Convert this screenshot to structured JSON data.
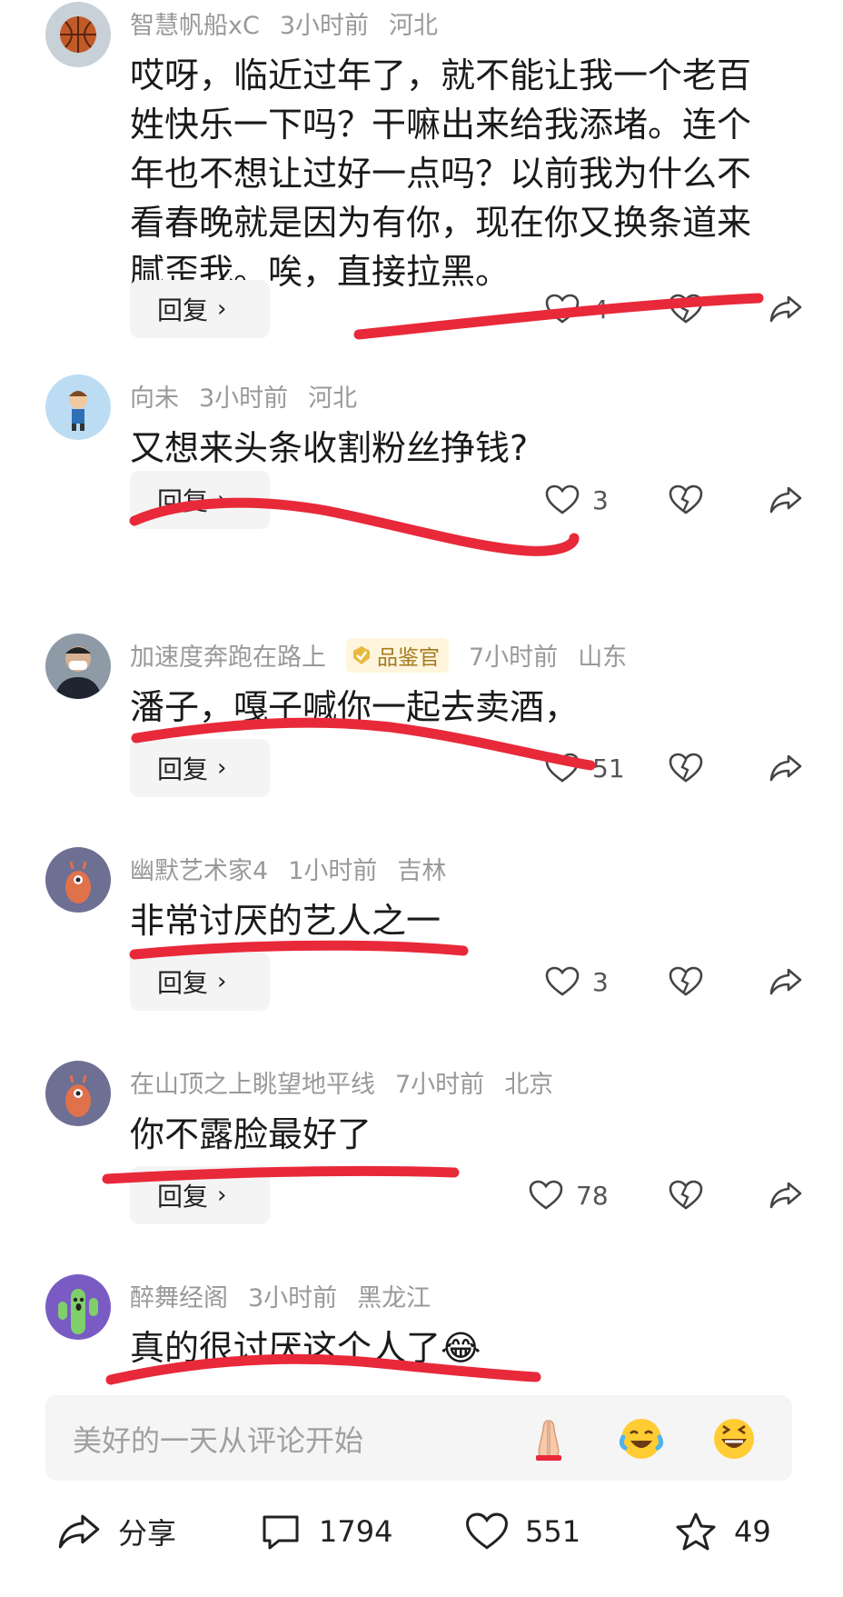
{
  "comments": [
    {
      "username": "智慧帆船xC",
      "time": "3小时前",
      "location": "河北",
      "text": "哎呀，临近过年了，就不能让我一个老百姓快乐一下吗？干嘛出来给我添堵。连个年也不想让过好一点吗？以前我为什么不看春晚就是因为有你，现在你又换条道来腻歪我。唉，直接拉黑。",
      "reply_label": "回复",
      "likes": "4",
      "avatar_icon": "basketball-avatar"
    },
    {
      "username": "向未",
      "time": "3小时前",
      "location": "河北",
      "text": "又想来头条收割粉丝挣钱?",
      "reply_label": "回复",
      "likes": "3",
      "avatar_icon": "cartoon-boy-avatar"
    },
    {
      "username": "加速度奔跑在路上",
      "badge": "品鉴官",
      "time": "7小时前",
      "location": "山东",
      "text": "潘子，嘎子喊你一起去卖酒，",
      "reply_label": "回复",
      "likes": "51",
      "avatar_icon": "masked-man-avatar"
    },
    {
      "username": "幽默艺术家4",
      "time": "1小时前",
      "location": "吉林",
      "text": "非常讨厌的艺人之一",
      "reply_label": "回复",
      "likes": "3",
      "avatar_icon": "owl-avatar"
    },
    {
      "username": "在山顶之上眺望地平线",
      "time": "7小时前",
      "location": "北京",
      "text": "你不露脸最好了",
      "reply_label": "回复",
      "likes": "78",
      "avatar_icon": "owl-avatar"
    },
    {
      "username": "醉舞经阁",
      "time": "3小时前",
      "location": "黑龙江",
      "text": "真的很讨厌这个人了😂",
      "avatar_icon": "cactus-avatar"
    }
  ],
  "input": {
    "placeholder": "美好的一天从评论开始",
    "emojis": [
      "🙏",
      "😂",
      "😄"
    ]
  },
  "bottom_bar": {
    "share_label": "分享",
    "comment_count": "1794",
    "like_count": "551",
    "favorite_count": "49"
  },
  "colors": {
    "annotation_red": "#e8293a",
    "meta_gray": "#999999",
    "badge_bg": "#fff5dd",
    "badge_text": "#a47a1e"
  }
}
